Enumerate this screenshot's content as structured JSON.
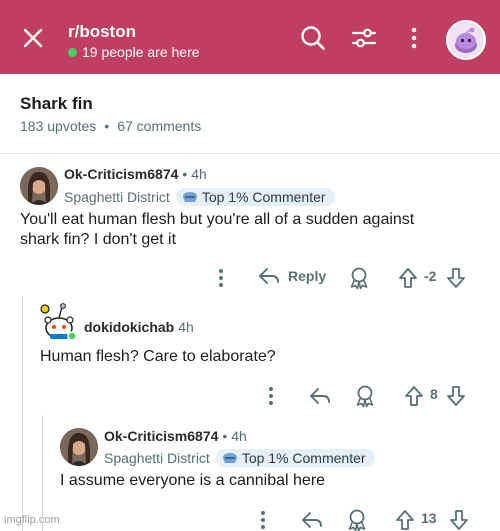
{
  "header": {
    "subreddit": "r/boston",
    "online": "19 people are here",
    "bg_color": "#c03e64",
    "icons": [
      "close-icon",
      "search-icon",
      "sort-filter-icon",
      "overflow-menu-icon",
      "avatar"
    ]
  },
  "post": {
    "title": "Shark fin",
    "upvotes": "183 upvotes",
    "comments": "67 comments"
  },
  "comments": [
    {
      "user": "Ok-Criticism6874",
      "time": "• 4h",
      "flair": "Spaghetti District",
      "badge": "Top 1% Commenter",
      "text_line1": "You'll eat human flesh but you're all of a sudden against",
      "text_line2": "shark fin? I don't get it",
      "reply_label": "Reply",
      "score": "-2"
    },
    {
      "user": "dokidokichab",
      "time": "4h",
      "text": "Human flesh? Care to elaborate?",
      "score": "8"
    },
    {
      "user": "Ok-Criticism6874",
      "time": "• 4h",
      "flair": "Spaghetti District",
      "badge": "Top 1% Commenter",
      "text": "I assume everyone is a cannibal here",
      "score": "13"
    }
  ],
  "watermark": "imgflip.com"
}
